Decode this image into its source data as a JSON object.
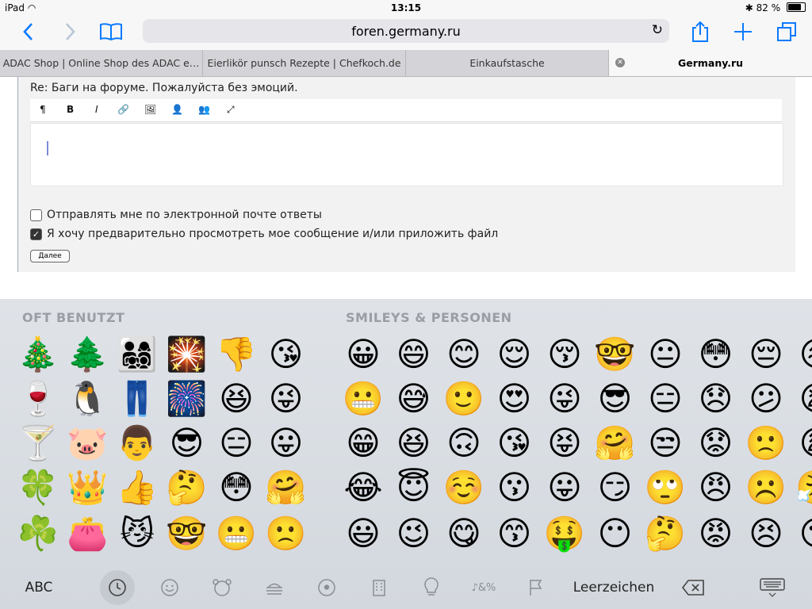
{
  "status": {
    "device": "iPad",
    "time": "13:15",
    "battery_text": "82 %",
    "battery_level": 0.82
  },
  "browser": {
    "url": "foren.germany.ru",
    "tabs": [
      {
        "label": "ADAC Shop | Online Shop des ADAC e…"
      },
      {
        "label": "Eierlikör punsch Rezepte | Chefkoch.de"
      },
      {
        "label": "Einkaufstasche"
      },
      {
        "label": "Germany.ru"
      }
    ]
  },
  "page": {
    "subject": "Re: Баги на форуме. Пожалуйста без эмоций.",
    "editor_tools": [
      "¶",
      "B",
      "I",
      "🔗",
      "🖼",
      "👤",
      "👥",
      "⤢"
    ],
    "checkbox1_label": "Отправлять мне по электронной почте ответы",
    "checkbox1_checked": false,
    "checkbox2_label": "Я хочу предварительно просмотреть мое сообщение и/или приложить файл",
    "checkbox2_checked": true,
    "next_button": "Далее"
  },
  "keyboard": {
    "recent_title": "OFT BENUTZT",
    "smileys_title": "SMILEYS & PERSONEN",
    "recent_columns": [
      [
        "🎄",
        "🍷",
        "🍸",
        "🍀",
        "☘️"
      ],
      [
        "🌲",
        "🐧",
        "🐷",
        "👑",
        "👛"
      ],
      [
        "👨‍👩‍👧‍👦",
        "👖",
        "👨",
        "👍",
        "😼"
      ],
      [
        "🎇",
        "🎆",
        "😎",
        "🤔",
        "🤓"
      ],
      [
        "👎",
        "😆",
        "😑",
        "😳",
        "😬"
      ],
      [
        "😘",
        "😜",
        "😛",
        "🤗",
        "🙁"
      ]
    ],
    "smiley_columns": [
      [
        "😀",
        "😬",
        "😁",
        "😂",
        "😃"
      ],
      [
        "😄",
        "😅",
        "😆",
        "😇",
        "😉"
      ],
      [
        "😊",
        "🙂",
        "🙃",
        "☺️",
        "😋"
      ],
      [
        "😌",
        "😍",
        "😘",
        "😗",
        "😙"
      ],
      [
        "😚",
        "😜",
        "😝",
        "😛",
        "🤑"
      ],
      [
        "🤓",
        "😎",
        "🤗",
        "😏",
        "😶"
      ],
      [
        "😐",
        "😑",
        "😒",
        "🙄",
        "🤔"
      ],
      [
        "😳",
        "😞",
        "😟",
        "😠",
        "😡"
      ],
      [
        "😔",
        "😕",
        "🙁",
        "☹️",
        "😣"
      ],
      [
        "😖",
        "😫",
        "😩",
        "😤",
        "😮"
      ]
    ],
    "abc_label": "ABC",
    "space_label": "Leerzeichen",
    "category_icons": [
      "🕘",
      "😀",
      "🐻",
      "🍔",
      "⚽",
      "🏢",
      "💡",
      "🔣",
      "🏳"
    ]
  }
}
